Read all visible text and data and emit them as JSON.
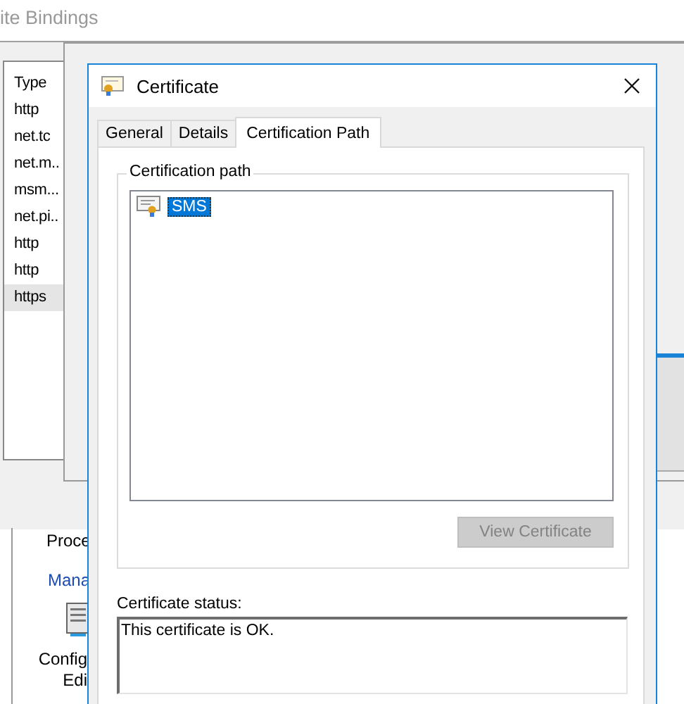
{
  "site_bindings": {
    "title": "ite Bindings",
    "list": {
      "column": "Type",
      "rows": [
        {
          "label": "http",
          "selected": false
        },
        {
          "label": "net.tc",
          "selected": false
        },
        {
          "label": "net.m..",
          "selected": false
        },
        {
          "label": "msm...",
          "selected": false
        },
        {
          "label": "net.pi..",
          "selected": false
        },
        {
          "label": "http",
          "selected": false
        },
        {
          "label": "http",
          "selected": false
        },
        {
          "label": "https",
          "selected": true
        }
      ]
    },
    "actions": [
      {
        "kind": "text",
        "label": "Proce"
      },
      {
        "kind": "link",
        "label": "Mana"
      },
      {
        "kind": "feature",
        "lines": [
          "Config",
          "Edi"
        ]
      }
    ]
  },
  "certificate": {
    "title": "Certificate",
    "tabs": [
      {
        "label": "General",
        "selected": false
      },
      {
        "label": "Details",
        "selected": false
      },
      {
        "label": "Certification Path",
        "selected": true
      }
    ],
    "group_label": "Certification path",
    "tree": [
      {
        "label": "SMS",
        "selected": true
      }
    ],
    "view_button": {
      "label": "View Certificate",
      "disabled": true
    },
    "status_label": "Certificate status:",
    "status_text": "This certificate is OK."
  }
}
